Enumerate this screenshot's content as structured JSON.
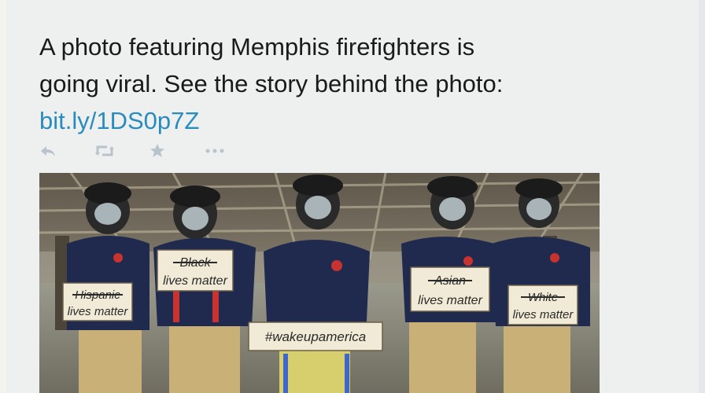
{
  "tweet": {
    "text_line1": "A photo featuring Memphis firefighters is",
    "text_line2": "going viral. See the story behind the photo:",
    "link": "bit.ly/1DS0p7Z"
  },
  "actions": [
    {
      "name": "reply",
      "icon": "reply-icon"
    },
    {
      "name": "retweet",
      "icon": "retweet-icon"
    },
    {
      "name": "favorite",
      "icon": "star-icon"
    },
    {
      "name": "more",
      "icon": "more-icon"
    }
  ],
  "photo": {
    "signs": {
      "sign1_strike": "Hispanic",
      "sign1_line": "lives matter",
      "sign2_strike": "Black",
      "sign2_line": "lives matter",
      "sign3": "#wakeupamerica",
      "sign4_strike": "Asian",
      "sign4_line": "lives matter",
      "sign5_strike": "White",
      "sign5_line": "lives matter"
    }
  },
  "colors": {
    "link": "#2a8bbd",
    "text": "#1a1a1a",
    "icon": "#b8c3cc",
    "shirt": "#1f2a4e",
    "turnout_pants": "#c8b077"
  }
}
